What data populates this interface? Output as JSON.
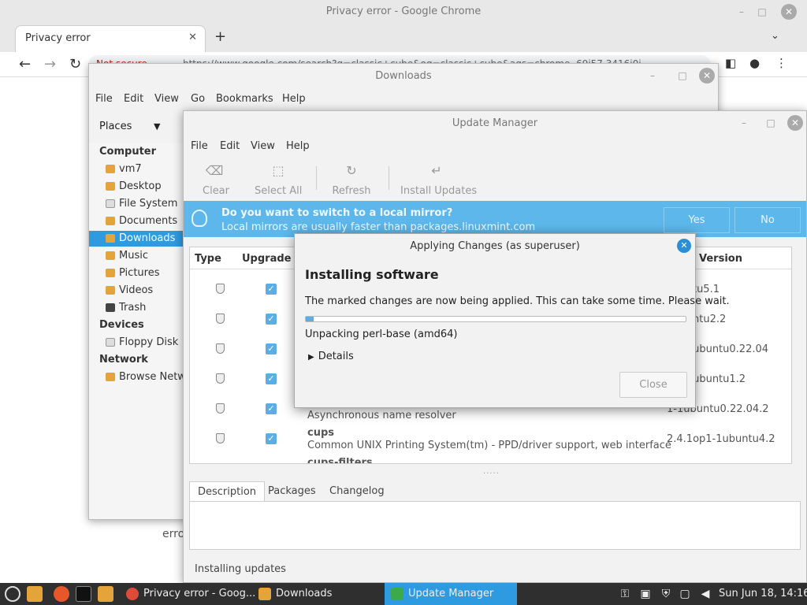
{
  "chrome": {
    "window_title": "Privacy error - Google Chrome",
    "tab_title": "Privacy error",
    "not_secure": "Not secure",
    "url": "https://www.google.com/search?q=classic+cube&oq=classic+cube&aqs=chrome..69i57.3416j0j",
    "page_fragment": "erro"
  },
  "downloads": {
    "title": "Downloads",
    "menu": [
      "File",
      "Edit",
      "View",
      "Go",
      "Bookmarks",
      "Help"
    ],
    "places_label": "Places",
    "sections": {
      "computer": "Computer",
      "devices": "Devices",
      "network": "Network"
    },
    "computer_items": [
      "vm7",
      "Desktop",
      "File System",
      "Documents",
      "Downloads",
      "Music",
      "Pictures",
      "Videos",
      "Trash"
    ],
    "device_items": [
      "Floppy Disk"
    ],
    "network_items": [
      "Browse Network"
    ]
  },
  "update_manager": {
    "title": "Update Manager",
    "menu": [
      "File",
      "Edit",
      "View",
      "Help"
    ],
    "toolbar": {
      "clear": "Clear",
      "select_all": "Select All",
      "refresh": "Refresh",
      "install": "Install Updates"
    },
    "mirror": {
      "question": "Do you want to switch to a local mirror?",
      "subtitle": "Local mirrors are usually faster than packages.linuxmint.com",
      "yes": "Yes",
      "no": "No"
    },
    "columns": {
      "type": "Type",
      "upgrade": "Upgrade",
      "version": "Version"
    },
    "rows": [
      {
        "name": "",
        "desc": "",
        "version": "ubuntu5.1"
      },
      {
        "name": "",
        "desc": "",
        "version": "4ubuntu2.2"
      },
      {
        "name": "",
        "desc": "",
        "version": "0311ubuntu0.22.04"
      },
      {
        "name": "",
        "desc": "",
        "version": "0909ubuntu1.2"
      },
      {
        "name": "",
        "desc": "Asynchronous name resolver",
        "version": "1-1ubuntu0.22.04.2"
      },
      {
        "name": "cups",
        "desc": "Common UNIX Printing System(tm) - PPD/driver support, web interface",
        "version": "2.4.1op1-1ubuntu4.2"
      },
      {
        "name": "cups-filters",
        "desc": "",
        "version": ""
      }
    ],
    "tabs": [
      "Description",
      "Packages",
      "Changelog"
    ],
    "status": "Installing updates"
  },
  "dialog": {
    "title": "Applying Changes (as superuser)",
    "heading": "Installing software",
    "message": "The marked changes are now being applied. This can take some time. Please wait.",
    "step": "Unpacking perl-base (amd64)",
    "details": "Details",
    "close": "Close",
    "progress_percent": 2
  },
  "taskbar": {
    "tasks": [
      "Privacy error - Goog...",
      "Downloads",
      "Update Manager"
    ],
    "clock": "Sun Jun 18, 14:16"
  }
}
